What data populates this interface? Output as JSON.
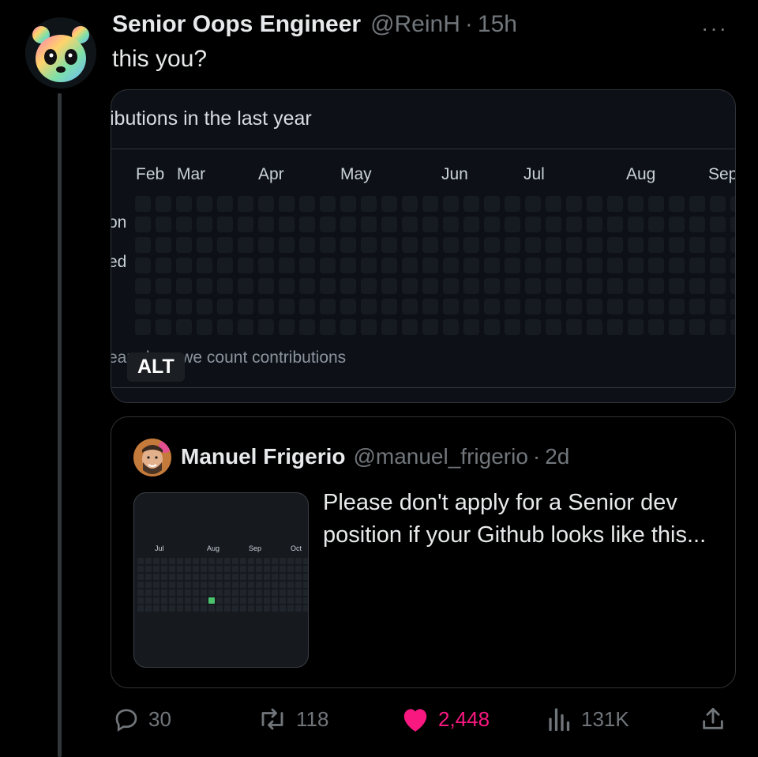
{
  "tweet": {
    "author_name": "Senior Oops Engineer",
    "author_handle": "@ReinH",
    "separator": "·",
    "time": "15h",
    "more": "···",
    "text": "this you?"
  },
  "media": {
    "title": "ibutions in the last year",
    "months": [
      "Feb",
      "Mar",
      "Apr",
      "May",
      "Jun",
      "Jul",
      "Aug",
      "Sep"
    ],
    "day_labels": [
      "on",
      "ed"
    ],
    "footer_text": "earn how we count contributions",
    "alt_label": "ALT"
  },
  "quote": {
    "author_name": "Manuel Frigerio",
    "author_handle": "@manuel_frigerio",
    "separator": "·",
    "time": "2d",
    "text": "Please don't apply for a Senior dev position if your Github looks like this...",
    "thumb_months": [
      "Jul",
      "Aug",
      "Sep",
      "Oct"
    ]
  },
  "actions": {
    "replies": "30",
    "retweets": "118",
    "likes": "2,448",
    "views": "131K"
  },
  "colors": {
    "like": "#f91880",
    "muted": "#71767b",
    "contrib_green": "#4ac26b"
  },
  "icons": [
    "more-icon",
    "reply-icon",
    "retweet-icon",
    "heart-icon",
    "views-icon",
    "share-icon"
  ]
}
